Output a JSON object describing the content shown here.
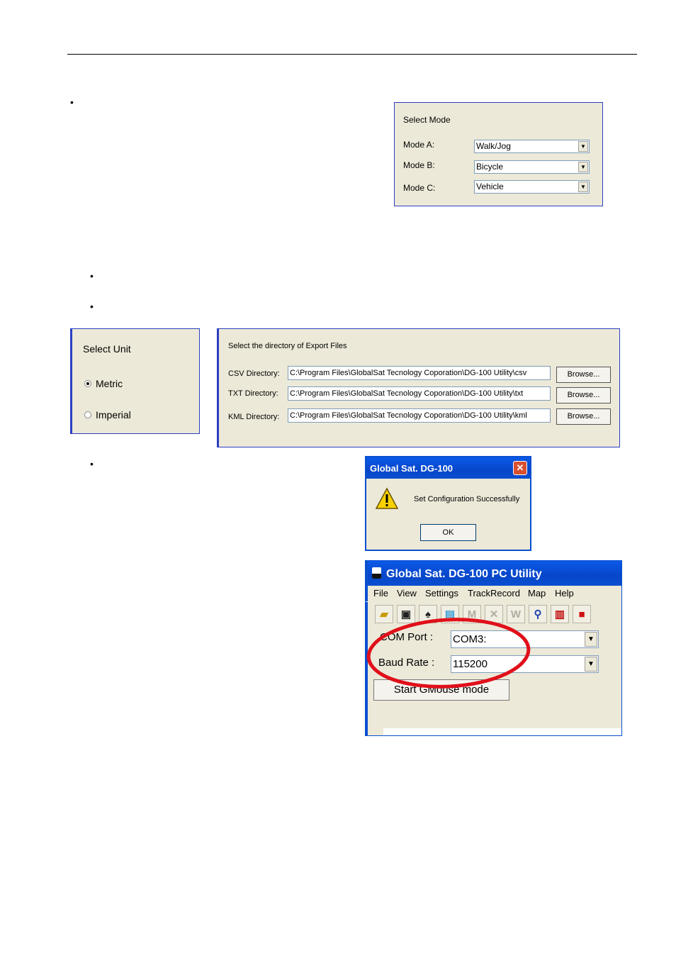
{
  "mode_panel": {
    "title": "Select Mode",
    "rows": [
      {
        "label": "Mode A:",
        "value": "Walk/Jog"
      },
      {
        "label": "Mode B:",
        "value": "Bicycle"
      },
      {
        "label": "Mode C:",
        "value": "Vehicle"
      }
    ]
  },
  "unit_panel": {
    "title": "Select Unit",
    "options": [
      {
        "label": "Metric",
        "selected": true
      },
      {
        "label": "Imperial",
        "selected": false
      }
    ]
  },
  "export_panel": {
    "title": "Select the directory of Export Files",
    "rows": [
      {
        "label": "CSV Directory:",
        "value": "C:\\Program Files\\GlobalSat Tecnology Coporation\\DG-100 Utility\\csv",
        "button": "Browse..."
      },
      {
        "label": "TXT Directory:",
        "value": "C:\\Program Files\\GlobalSat Tecnology Coporation\\DG-100 Utility\\txt",
        "button": "Browse..."
      },
      {
        "label": "KML Directory:",
        "value": "C:\\Program Files\\GlobalSat Tecnology Coporation\\DG-100 Utility\\kml",
        "button": "Browse..."
      }
    ]
  },
  "message_box": {
    "title": "Global Sat. DG-100",
    "close": "✕",
    "message": "Set Configuration Successfully",
    "ok": "OK"
  },
  "app_window": {
    "title": "Global Sat. DG-100 PC Utility",
    "menu": [
      "File",
      "View",
      "Settings",
      "TrackRecord",
      "Map",
      "Help"
    ],
    "com_port_label": "COM Port :",
    "com_port_value": "COM3:",
    "baud_rate_label": "Baud Rate :",
    "baud_rate_value": "115200",
    "gmouse_button": "Start GMouse mode",
    "highlight_color": "#e0101a"
  },
  "colors": {
    "panel_bg": "#ece9d8",
    "panel_border": "#2b3fc4",
    "xp_title": "#0a4fcf"
  }
}
